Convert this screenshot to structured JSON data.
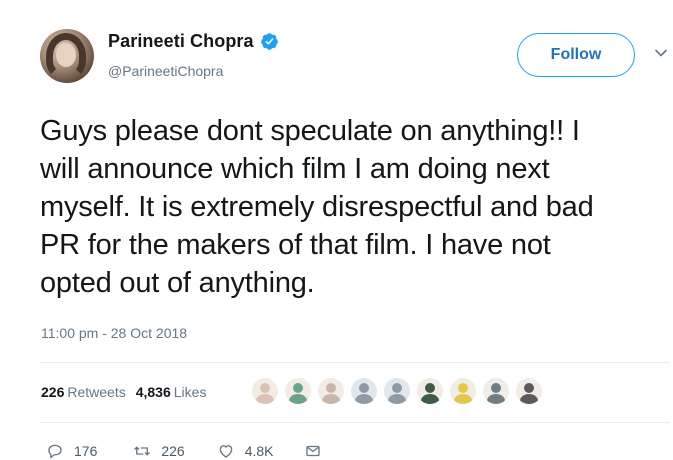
{
  "author": {
    "display_name": "Parineeti Chopra",
    "handle": "@ParineetiChopra",
    "verified": true
  },
  "follow_button": {
    "label": "Follow"
  },
  "tweet": {
    "lines": [
      "Guys please dont speculate on anything!! I",
      "will announce which film I am doing next",
      "myself. It is extremely disrespectful and bad",
      "PR for the makers of that film. I have not",
      "opted out of anything."
    ],
    "timestamp": "11:00 pm - 28 Oct 2018"
  },
  "stats": {
    "retweets_count": "226",
    "retweets_label": "Retweets",
    "likes_count": "4,836",
    "likes_label": "Likes"
  },
  "likers": [
    {
      "icon": "avatar-icon",
      "color": "#d8c3b5"
    },
    {
      "icon": "avatar-icon",
      "color": "#6aa58a"
    },
    {
      "icon": "avatar-icon",
      "color": "#c9b6a8"
    },
    {
      "icon": "default-avatar-icon",
      "color": "#8f9aa5"
    },
    {
      "icon": "default-avatar-icon",
      "color": "#8f9aa5"
    },
    {
      "icon": "avatar-icon",
      "color": "#3f5a45"
    },
    {
      "icon": "avatar-icon",
      "color": "#e2c94a"
    },
    {
      "icon": "avatar-icon",
      "color": "#6e7d86"
    },
    {
      "icon": "avatar-icon",
      "color": "#5b5b5b"
    }
  ],
  "actions": {
    "replies": "176",
    "retweets": "226",
    "likes": "4.8K"
  },
  "colors": {
    "accent": "#1da1f2",
    "muted": "#657786",
    "divider": "#e6ecf0"
  }
}
